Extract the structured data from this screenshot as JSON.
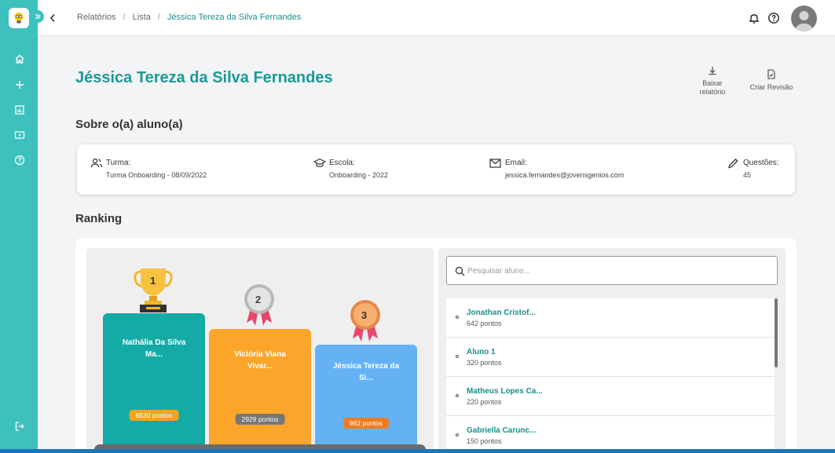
{
  "breadcrumb": {
    "items": [
      "Relatórios",
      "Lista",
      "Jéssica Tereza da Silva Fernandes"
    ],
    "separator": "/"
  },
  "page": {
    "title": "Jéssica Tereza da Silva Fernandes"
  },
  "actions": {
    "download_line1": "Baixar",
    "download_line2": "relatório",
    "review": "Criar Revisão"
  },
  "about": {
    "title": "Sobre o(a) aluno(a)",
    "turma_label": "Turma:",
    "turma_value": "Turma Onboarding - 08/09/2022",
    "escola_label": "Escola:",
    "escola_value": "Onboarding - 2022",
    "email_label": "Email:",
    "email_value": "jessica.fernandes@jovensgenios.com",
    "questoes_label": "Questões:",
    "questoes_value": "45"
  },
  "ranking": {
    "title": "Ranking",
    "podium": [
      {
        "place": "1",
        "name_line1": "Nathália Da Silva",
        "name_line2": "Ma...",
        "points": "6530 pontos"
      },
      {
        "place": "2",
        "name_line1": "Victória Viana",
        "name_line2": "Vivar...",
        "points": "2929 pontos"
      },
      {
        "place": "3",
        "name_line1": "Jéssica Tereza da",
        "name_line2": "Si...",
        "points": "962 pontos"
      }
    ],
    "search_placeholder": "Pesquisar aluno...",
    "students": [
      {
        "name": "Jonathan Cristof...",
        "points": "642 pontos"
      },
      {
        "name": "Aluno 1",
        "points": "320 pontos"
      },
      {
        "name": "Matheus Lopes Ca...",
        "points": "220 pontos"
      },
      {
        "name": "Gabriella Carunc...",
        "points": "150 pontos"
      }
    ]
  },
  "colors": {
    "brand": "#3cc1be",
    "title": "#1a9a96",
    "first": "#14aaa6",
    "second": "#fba62a",
    "third": "#64b2f4",
    "gold_badge": "#f2a51f",
    "silver_badge": "#777777",
    "bronze_badge": "#f07b1e"
  },
  "icons": {
    "sidebar": [
      "home-icon",
      "plus-icon",
      "chart-icon",
      "video-icon",
      "help-icon",
      "logout-icon"
    ],
    "topbar": [
      "bell-icon",
      "help-icon",
      "avatar"
    ]
  }
}
